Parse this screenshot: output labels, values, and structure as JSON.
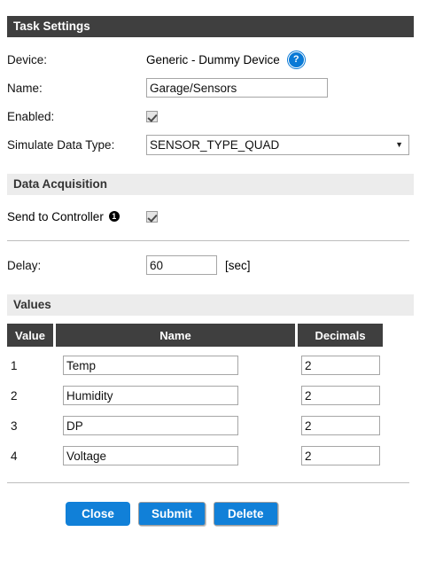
{
  "sections": {
    "task_settings": "Task Settings",
    "data_acquisition": "Data Acquisition",
    "values": "Values"
  },
  "task_settings": {
    "device": {
      "label": "Device:",
      "value": "Generic - Dummy Device",
      "help_icon": "help-question-icon",
      "help_glyph": "?"
    },
    "name": {
      "label": "Name:",
      "value": "Garage/Sensors",
      "placeholder": ""
    },
    "enabled": {
      "label": "Enabled:",
      "checked": true
    },
    "simulate_data_type": {
      "label": "Simulate Data Type:",
      "selected": "SENSOR_TYPE_QUAD",
      "options": [
        "SENSOR_TYPE_QUAD"
      ],
      "arrow_glyph": "▼"
    }
  },
  "data_acquisition": {
    "send_to_controller": {
      "label": "Send to Controller",
      "info_glyph": "1",
      "checked": true
    },
    "delay": {
      "label": "Delay:",
      "value": "60",
      "unit": "[sec]"
    }
  },
  "values_table": {
    "columns": [
      "Value",
      "Name",
      "Decimals"
    ],
    "rows": [
      {
        "index": "1",
        "name": "Temp",
        "decimals": "2"
      },
      {
        "index": "2",
        "name": "Humidity",
        "decimals": "2"
      },
      {
        "index": "3",
        "name": "DP",
        "decimals": "2"
      },
      {
        "index": "4",
        "name": "Voltage",
        "decimals": "2"
      }
    ]
  },
  "footer": {
    "close_label": "Close",
    "submit_label": "Submit",
    "delete_label": "Delete"
  },
  "colors": {
    "header_dark": "#3f3f3f",
    "header_light": "#ececec",
    "accent_blue": "#1180d8",
    "help_blue": "#0a7ad6",
    "border_gray": "#a6a6a6"
  }
}
